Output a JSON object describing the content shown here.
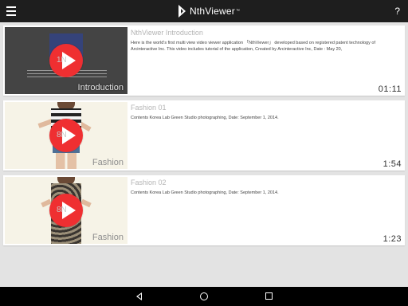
{
  "app": {
    "name": "NthViewer",
    "trademark": "™"
  },
  "videos": [
    {
      "title": "NthViewer Introduction",
      "description": "Here is the world's first multi view video viewer application 「NthViewer」 developed based on registered patent technology of Arcinteractive Inc. This video includes tutorial of the application, Created by Arcinteractive Inc, Date : May 20,",
      "duration": "01:11",
      "thumb_caption": "Introduction",
      "thumb_badge": "1N"
    },
    {
      "title": "Fashion 01",
      "description": "Contents Korea Lab Green Studio photographing, Date: September 1, 2014.",
      "duration": "1:54",
      "thumb_caption": "Fashion",
      "thumb_badge": "8N"
    },
    {
      "title": "Fashion 02",
      "description": "Contents Korea Lab Green Studio photographing, Date: September 1, 2014.",
      "duration": "1:23",
      "thumb_caption": "Fashion",
      "thumb_badge": "8N"
    }
  ],
  "toolbar": {
    "help_label": "?"
  },
  "icons": {
    "menu": "hamburger-menu-icon",
    "help": "help-icon",
    "play": "play-icon",
    "back": "nav-back-icon",
    "home": "nav-home-icon",
    "recent": "nav-recent-apps-icon"
  },
  "colors": {
    "topbar": "#1e1e1e",
    "background": "#e3e3e3",
    "play_button": "#ef2f31",
    "navbar": "#000000"
  }
}
